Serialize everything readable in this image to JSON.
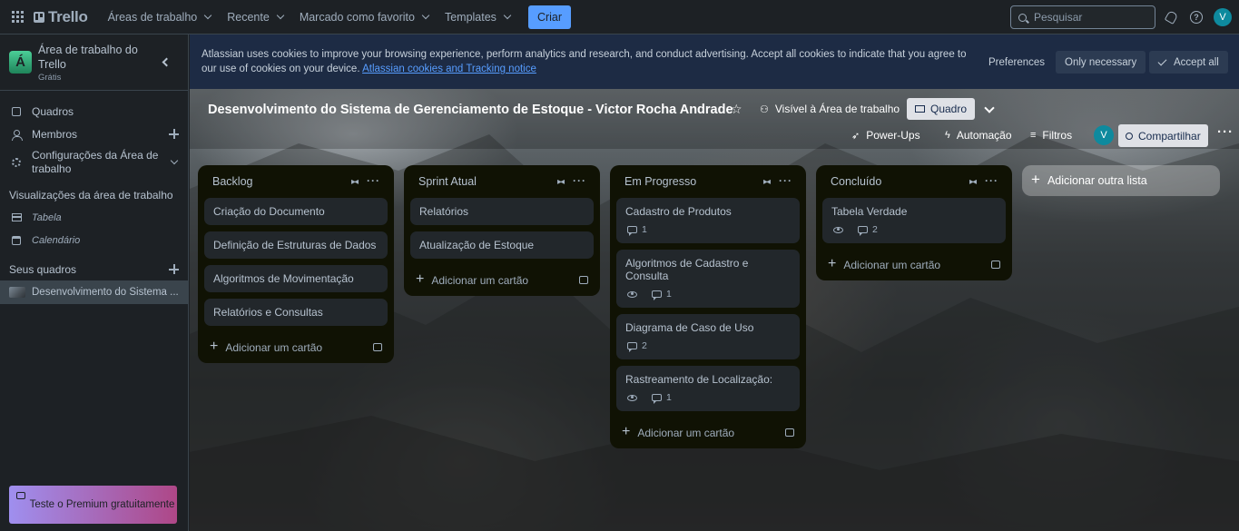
{
  "topbar": {
    "logo": "Trello",
    "nav": [
      "Áreas de trabalho",
      "Recente",
      "Marcado como favorito",
      "Templates"
    ],
    "create_label": "Criar",
    "search_placeholder": "Pesquisar",
    "avatar_initial": "V"
  },
  "sidebar": {
    "workspace_initial": "Á",
    "workspace_name": "Área de trabalho do Trello",
    "workspace_plan": "Grátis",
    "items": [
      {
        "label": "Quadros"
      },
      {
        "label": "Membros"
      },
      {
        "label": "Configurações da Área de trabalho"
      }
    ],
    "views_title": "Visualizações da área de trabalho",
    "views": [
      "Tabela",
      "Calendário"
    ],
    "boards_title": "Seus quadros",
    "boards": [
      "Desenvolvimento do Sistema ..."
    ],
    "premium_label": "Teste o Premium gratuitamente"
  },
  "cookie_banner": {
    "text": "Atlassian uses cookies to improve your browsing experience, perform analytics and research, and conduct advertising. Accept all cookies to indicate that you agree to our use of cookies on your device.",
    "link": "Atlassian cookies and Tracking notice",
    "preferences": "Preferences",
    "only_necessary": "Only necessary",
    "accept_all": "Accept all"
  },
  "board": {
    "title": "Desenvolvimento do Sistema de Gerenciamento de Estoque - Victor Rocha Andrade",
    "visibility": "Visível à Área de trabalho",
    "view": "Quadro",
    "powerups": "Power-Ups",
    "automation": "Automação",
    "filters": "Filtros",
    "member_initial": "V",
    "share": "Compartilhar",
    "add_list": "Adicionar outra lista",
    "add_card": "Adicionar um cartão",
    "lists": [
      {
        "name": "Backlog",
        "cards": [
          {
            "title": "Criação do Documento"
          },
          {
            "title": "Definição de Estruturas de Dados"
          },
          {
            "title": "Algoritmos de Movimentação"
          },
          {
            "title": "Relatórios e Consultas"
          }
        ]
      },
      {
        "name": "Sprint Atual",
        "cards": [
          {
            "title": "Relatórios"
          },
          {
            "title": "Atualização de Estoque"
          }
        ]
      },
      {
        "name": "Em Progresso",
        "cards": [
          {
            "title": "Cadastro de Produtos",
            "watch": false,
            "comments": "1"
          },
          {
            "title": "Algoritmos de Cadastro e Consulta",
            "watch": true,
            "comments": "1"
          },
          {
            "title": "Diagrama de Caso de Uso",
            "watch": false,
            "comments": "2"
          },
          {
            "title": "Rastreamento de Localização:",
            "watch": true,
            "comments": "1"
          }
        ]
      },
      {
        "name": "Concluído",
        "cards": [
          {
            "title": "Tabela Verdade",
            "watch": true,
            "comments": "2"
          }
        ]
      }
    ]
  }
}
